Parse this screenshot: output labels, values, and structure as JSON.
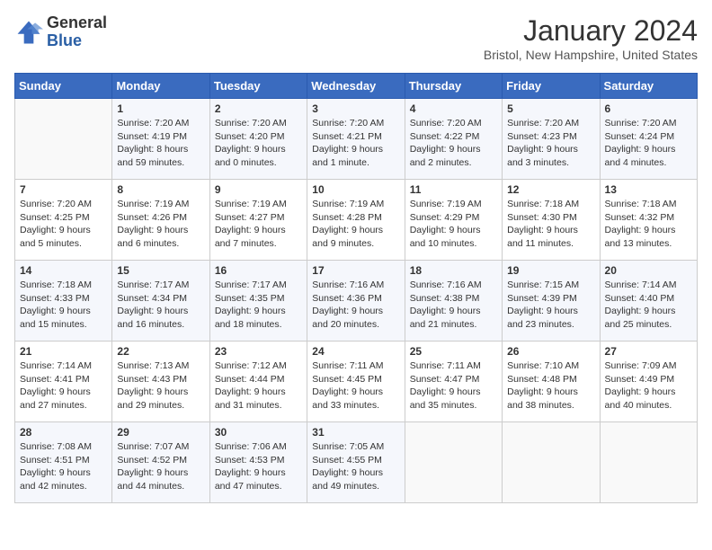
{
  "logo": {
    "line1": "General",
    "line2": "Blue"
  },
  "header": {
    "title": "January 2024",
    "subtitle": "Bristol, New Hampshire, United States"
  },
  "weekdays": [
    "Sunday",
    "Monday",
    "Tuesday",
    "Wednesday",
    "Thursday",
    "Friday",
    "Saturday"
  ],
  "weeks": [
    [
      {
        "day": "",
        "info": ""
      },
      {
        "day": "1",
        "info": "Sunrise: 7:20 AM\nSunset: 4:19 PM\nDaylight: 8 hours\nand 59 minutes."
      },
      {
        "day": "2",
        "info": "Sunrise: 7:20 AM\nSunset: 4:20 PM\nDaylight: 9 hours\nand 0 minutes."
      },
      {
        "day": "3",
        "info": "Sunrise: 7:20 AM\nSunset: 4:21 PM\nDaylight: 9 hours\nand 1 minute."
      },
      {
        "day": "4",
        "info": "Sunrise: 7:20 AM\nSunset: 4:22 PM\nDaylight: 9 hours\nand 2 minutes."
      },
      {
        "day": "5",
        "info": "Sunrise: 7:20 AM\nSunset: 4:23 PM\nDaylight: 9 hours\nand 3 minutes."
      },
      {
        "day": "6",
        "info": "Sunrise: 7:20 AM\nSunset: 4:24 PM\nDaylight: 9 hours\nand 4 minutes."
      }
    ],
    [
      {
        "day": "7",
        "info": "Sunrise: 7:20 AM\nSunset: 4:25 PM\nDaylight: 9 hours\nand 5 minutes."
      },
      {
        "day": "8",
        "info": "Sunrise: 7:19 AM\nSunset: 4:26 PM\nDaylight: 9 hours\nand 6 minutes."
      },
      {
        "day": "9",
        "info": "Sunrise: 7:19 AM\nSunset: 4:27 PM\nDaylight: 9 hours\nand 7 minutes."
      },
      {
        "day": "10",
        "info": "Sunrise: 7:19 AM\nSunset: 4:28 PM\nDaylight: 9 hours\nand 9 minutes."
      },
      {
        "day": "11",
        "info": "Sunrise: 7:19 AM\nSunset: 4:29 PM\nDaylight: 9 hours\nand 10 minutes."
      },
      {
        "day": "12",
        "info": "Sunrise: 7:18 AM\nSunset: 4:30 PM\nDaylight: 9 hours\nand 11 minutes."
      },
      {
        "day": "13",
        "info": "Sunrise: 7:18 AM\nSunset: 4:32 PM\nDaylight: 9 hours\nand 13 minutes."
      }
    ],
    [
      {
        "day": "14",
        "info": "Sunrise: 7:18 AM\nSunset: 4:33 PM\nDaylight: 9 hours\nand 15 minutes."
      },
      {
        "day": "15",
        "info": "Sunrise: 7:17 AM\nSunset: 4:34 PM\nDaylight: 9 hours\nand 16 minutes."
      },
      {
        "day": "16",
        "info": "Sunrise: 7:17 AM\nSunset: 4:35 PM\nDaylight: 9 hours\nand 18 minutes."
      },
      {
        "day": "17",
        "info": "Sunrise: 7:16 AM\nSunset: 4:36 PM\nDaylight: 9 hours\nand 20 minutes."
      },
      {
        "day": "18",
        "info": "Sunrise: 7:16 AM\nSunset: 4:38 PM\nDaylight: 9 hours\nand 21 minutes."
      },
      {
        "day": "19",
        "info": "Sunrise: 7:15 AM\nSunset: 4:39 PM\nDaylight: 9 hours\nand 23 minutes."
      },
      {
        "day": "20",
        "info": "Sunrise: 7:14 AM\nSunset: 4:40 PM\nDaylight: 9 hours\nand 25 minutes."
      }
    ],
    [
      {
        "day": "21",
        "info": "Sunrise: 7:14 AM\nSunset: 4:41 PM\nDaylight: 9 hours\nand 27 minutes."
      },
      {
        "day": "22",
        "info": "Sunrise: 7:13 AM\nSunset: 4:43 PM\nDaylight: 9 hours\nand 29 minutes."
      },
      {
        "day": "23",
        "info": "Sunrise: 7:12 AM\nSunset: 4:44 PM\nDaylight: 9 hours\nand 31 minutes."
      },
      {
        "day": "24",
        "info": "Sunrise: 7:11 AM\nSunset: 4:45 PM\nDaylight: 9 hours\nand 33 minutes."
      },
      {
        "day": "25",
        "info": "Sunrise: 7:11 AM\nSunset: 4:47 PM\nDaylight: 9 hours\nand 35 minutes."
      },
      {
        "day": "26",
        "info": "Sunrise: 7:10 AM\nSunset: 4:48 PM\nDaylight: 9 hours\nand 38 minutes."
      },
      {
        "day": "27",
        "info": "Sunrise: 7:09 AM\nSunset: 4:49 PM\nDaylight: 9 hours\nand 40 minutes."
      }
    ],
    [
      {
        "day": "28",
        "info": "Sunrise: 7:08 AM\nSunset: 4:51 PM\nDaylight: 9 hours\nand 42 minutes."
      },
      {
        "day": "29",
        "info": "Sunrise: 7:07 AM\nSunset: 4:52 PM\nDaylight: 9 hours\nand 44 minutes."
      },
      {
        "day": "30",
        "info": "Sunrise: 7:06 AM\nSunset: 4:53 PM\nDaylight: 9 hours\nand 47 minutes."
      },
      {
        "day": "31",
        "info": "Sunrise: 7:05 AM\nSunset: 4:55 PM\nDaylight: 9 hours\nand 49 minutes."
      },
      {
        "day": "",
        "info": ""
      },
      {
        "day": "",
        "info": ""
      },
      {
        "day": "",
        "info": ""
      }
    ]
  ]
}
